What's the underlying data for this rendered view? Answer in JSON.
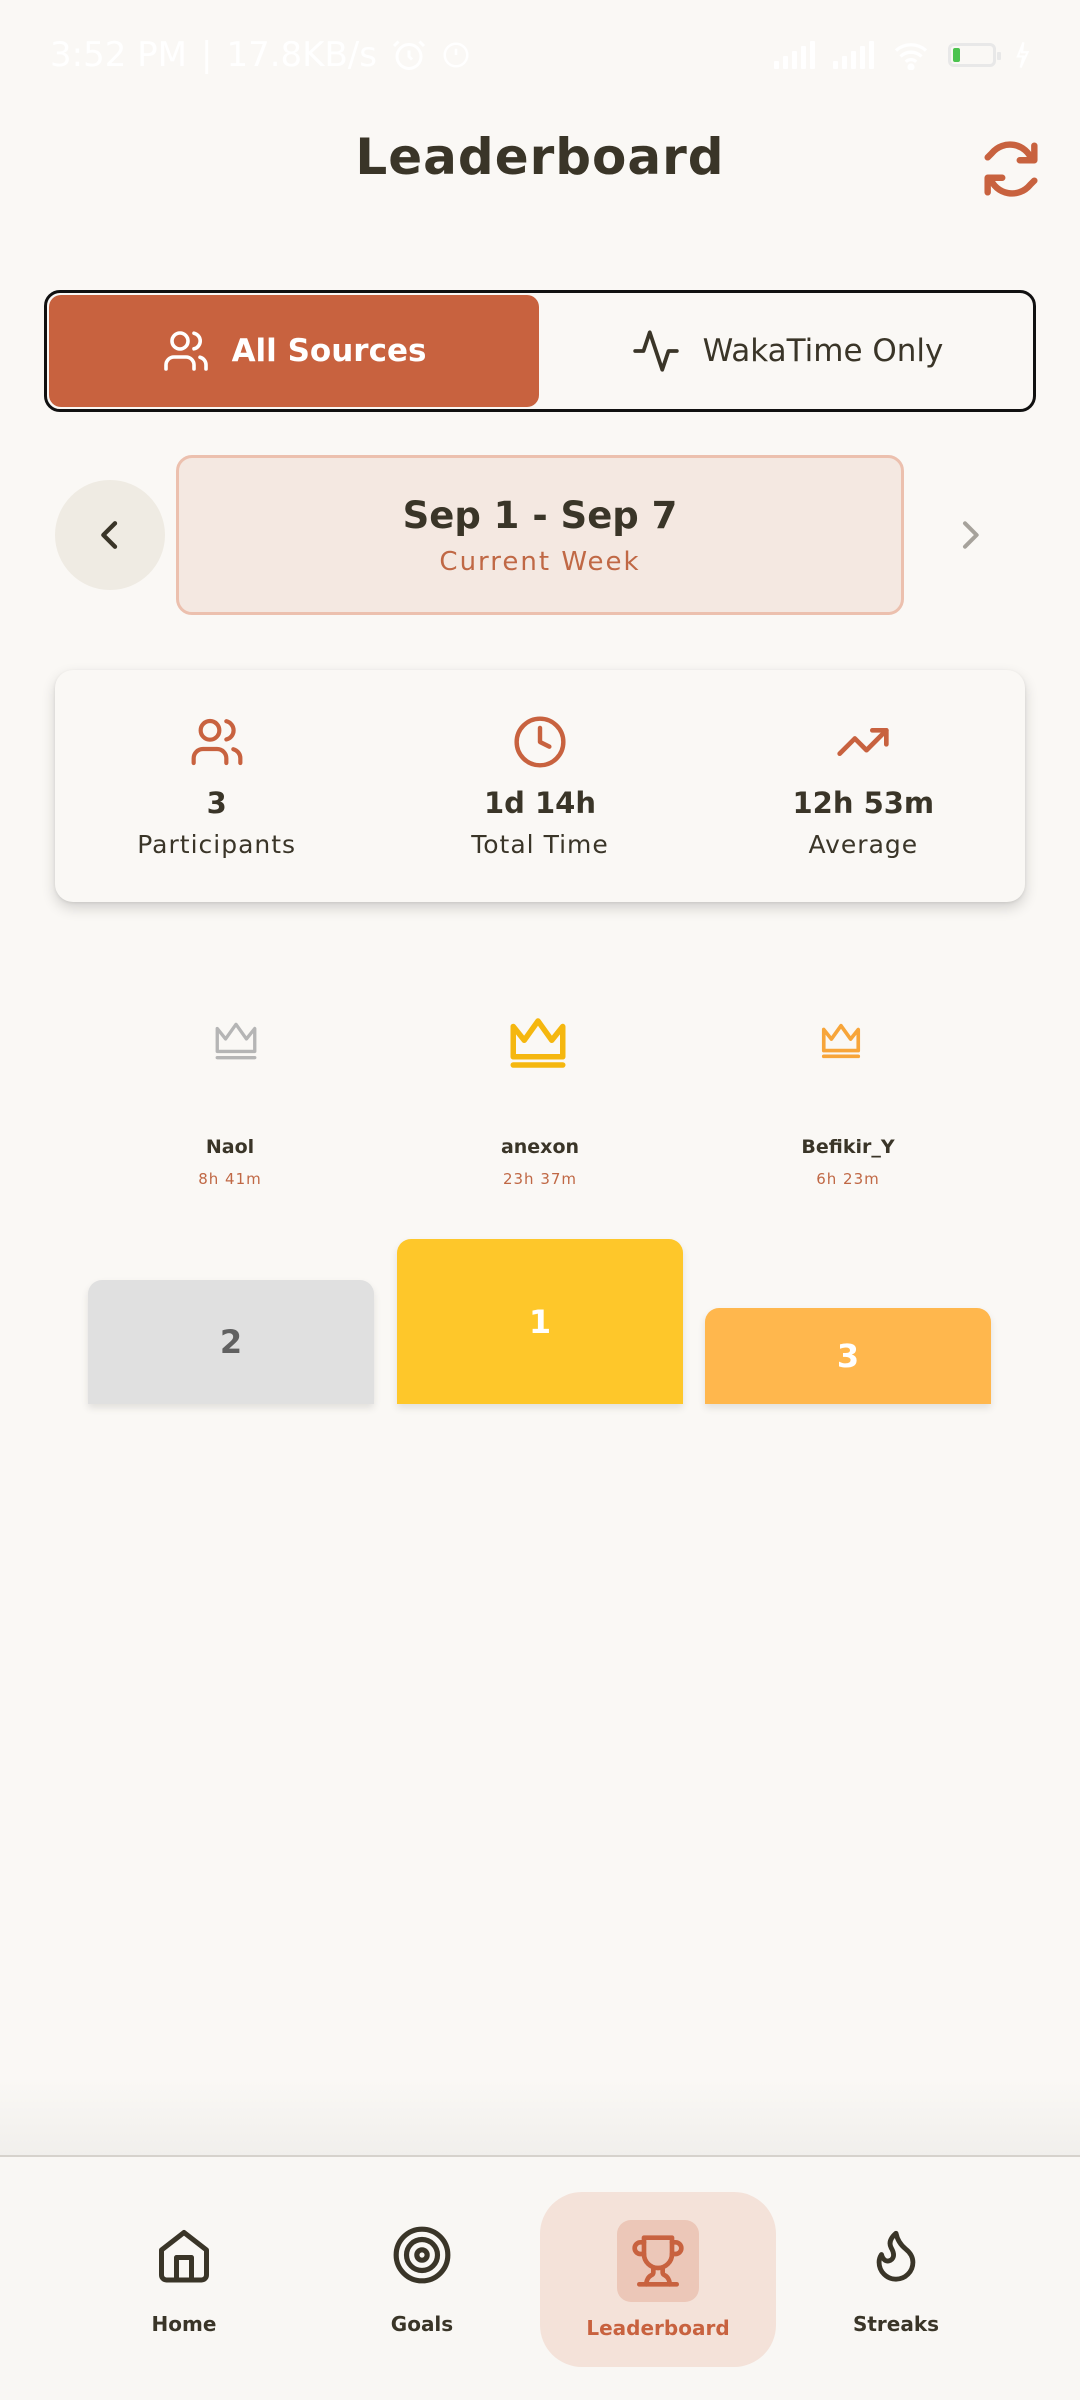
{
  "status_bar": {
    "time": "3:52 PM",
    "separator": "|",
    "net_speed": "17.8KB/s",
    "battery": "18"
  },
  "header": {
    "title": "Leaderboard"
  },
  "source_toggle": {
    "all_sources": "All Sources",
    "wakatime_only": "WakaTime Only",
    "selected": "All Sources"
  },
  "week": {
    "range": "Sep 1 - Sep 7",
    "subtitle": "Current Week"
  },
  "stats": [
    {
      "icon": "users-icon",
      "value": "3",
      "label": "Participants"
    },
    {
      "icon": "clock-icon",
      "value": "1d 14h",
      "label": "Total Time"
    },
    {
      "icon": "trending-up-icon",
      "value": "12h 53m",
      "label": "Average"
    }
  ],
  "podium": {
    "second": {
      "name": "Naol",
      "time": "8h 41m",
      "rank": "2",
      "color": "#e0e0e0"
    },
    "first": {
      "name": "anexon",
      "time": "23h 37m",
      "rank": "1",
      "color": "#fec72a"
    },
    "third": {
      "name": "Befikir_Y",
      "time": "6h 23m",
      "rank": "3",
      "color": "#ffb74d"
    }
  },
  "nav": {
    "home": "Home",
    "goals": "Goals",
    "leaderboard": "Leaderboard",
    "streaks": "Streaks",
    "active": "Leaderboard"
  },
  "colors": {
    "accent": "#c8623f",
    "background": "#faf8f5",
    "text": "#3a3528",
    "gold": "#fec72a",
    "silver": "#e0e0e0",
    "bronze": "#ffb74d"
  }
}
